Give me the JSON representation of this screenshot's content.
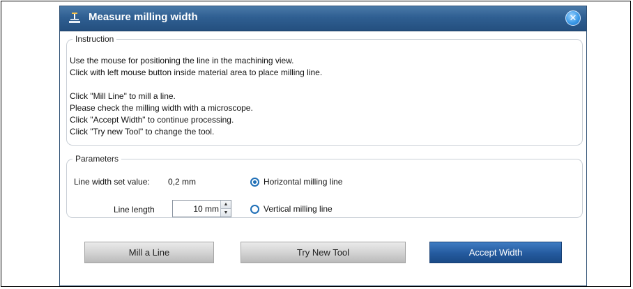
{
  "window": {
    "title": "Measure milling width",
    "app_icon": "machine-icon",
    "close_icon": "close-icon",
    "close_glyph": "✕"
  },
  "instruction": {
    "legend": "Instruction",
    "lines": [
      "Use the mouse for positioning the line in the machining view.",
      "Click with left mouse button inside material area to place milling line.",
      "",
      "Click \"Mill Line\" to mill a line.",
      "Please check the milling width with a microscope.",
      "Click \"Accept Width\" to continue processing.",
      "Click \"Try new Tool\" to change the tool."
    ]
  },
  "parameters": {
    "legend": "Parameters",
    "line_width_label": "Line width set value:",
    "line_width_value": "0,2 mm",
    "line_length_label": "Line length",
    "line_length_value": "10 mm",
    "options": [
      {
        "label": "Horizontal milling line",
        "checked": true
      },
      {
        "label": "Vertical milling line",
        "checked": false
      }
    ]
  },
  "buttons": {
    "mill": "Mill a Line",
    "try_tool": "Try New Tool",
    "accept": "Accept Width"
  },
  "colors": {
    "titlebar": "#2f5f92",
    "accent_button": "#245a9e",
    "radio": "#1f6fb7"
  }
}
